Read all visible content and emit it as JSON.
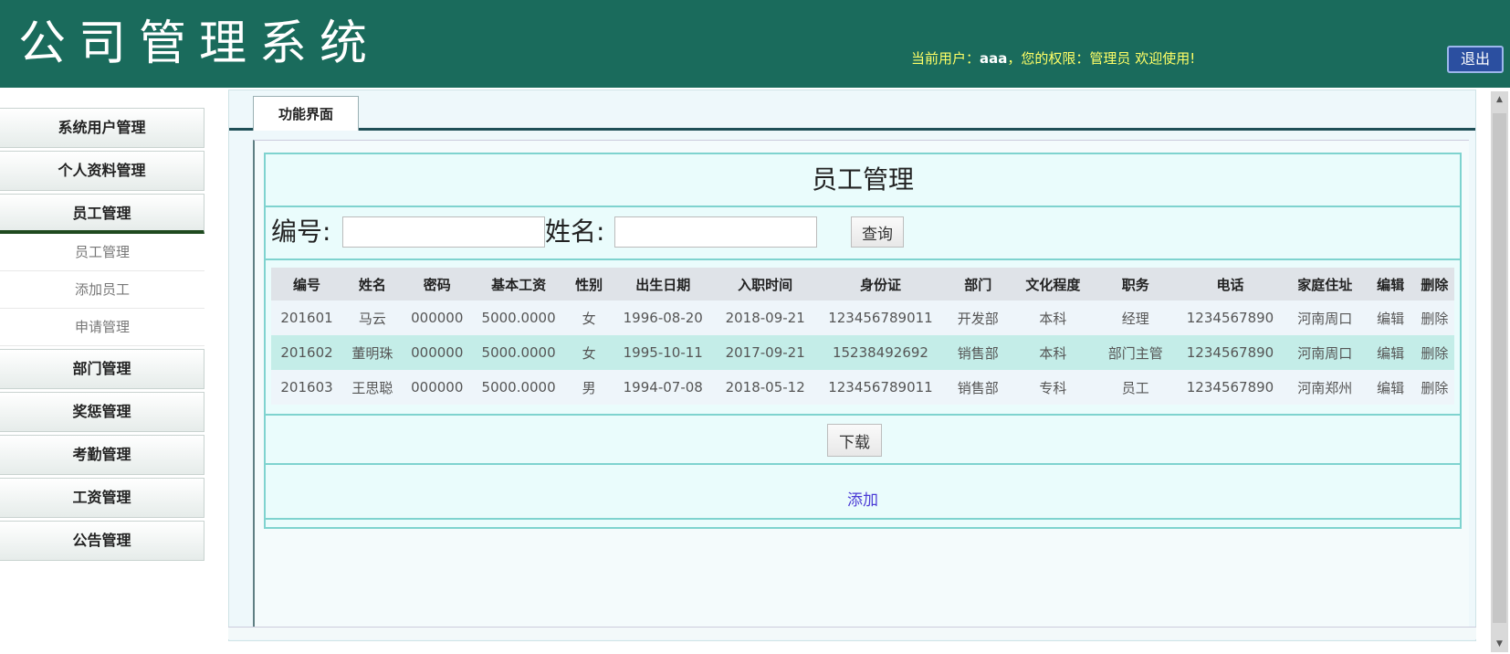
{
  "header": {
    "title": "公司管理系统",
    "user_prefix": "当前用户：",
    "username": "aaa",
    "permission_prefix": "，您的权限：",
    "role": "管理员",
    "welcome": " 欢迎使用!",
    "logout_label": "退出"
  },
  "colors": {
    "header_bg": "#1a6b5c",
    "welcome_text": "#ffff66",
    "logout_bg": "#2b4fa0",
    "table_alt_row": "#c4ede8",
    "link": "#4b3bd6"
  },
  "sidebar": {
    "menus": [
      {
        "label": "系统用户管理"
      },
      {
        "label": "个人资料管理"
      },
      {
        "label": "员工管理"
      },
      {
        "label": "部门管理"
      },
      {
        "label": "奖惩管理"
      },
      {
        "label": "考勤管理"
      },
      {
        "label": "工资管理"
      },
      {
        "label": "公告管理"
      }
    ],
    "submenu": [
      {
        "label": "员工管理"
      },
      {
        "label": "添加员工"
      },
      {
        "label": "申请管理"
      }
    ]
  },
  "tabs": [
    {
      "label": "功能界面",
      "active": true
    }
  ],
  "panel": {
    "title": "员工管理",
    "search": {
      "id_label": "编号:",
      "id_value": "",
      "name_label": "姓名:",
      "name_value": "",
      "query_label": "查询"
    },
    "table": {
      "columns": [
        "编号",
        "姓名",
        "密码",
        "基本工资",
        "性别",
        "出生日期",
        "入职时间",
        "身份证",
        "部门",
        "文化程度",
        "职务",
        "电话",
        "家庭住址",
        "编辑",
        "删除"
      ],
      "rows": [
        [
          "201601",
          "马云",
          "000000",
          "5000.0000",
          "女",
          "1996-08-20",
          "2018-09-21",
          "123456789011",
          "开发部",
          "本科",
          "经理",
          "1234567890",
          "河南周口",
          "编辑",
          "删除"
        ],
        [
          "201602",
          "董明珠",
          "000000",
          "5000.0000",
          "女",
          "1995-10-11",
          "2017-09-21",
          "15238492692",
          "销售部",
          "本科",
          "部门主管",
          "1234567890",
          "河南周口",
          "编辑",
          "删除"
        ],
        [
          "201603",
          "王思聪",
          "000000",
          "5000.0000",
          "男",
          "1994-07-08",
          "2018-05-12",
          "123456789011",
          "销售部",
          "专科",
          "员工",
          "1234567890",
          "河南郑州",
          "编辑",
          "删除"
        ]
      ]
    },
    "download_label": "下载",
    "add_label": "添加"
  }
}
